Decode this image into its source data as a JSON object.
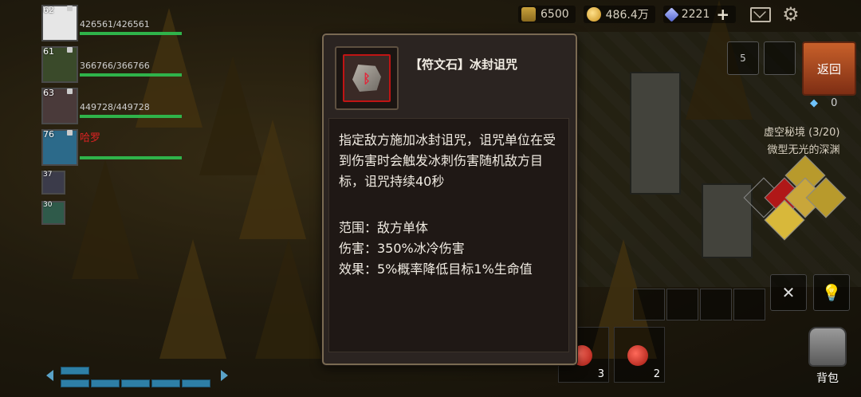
{
  "resources": {
    "wheat": "6500",
    "gold": "486.4万",
    "diamond": "2221",
    "plus": "+"
  },
  "party": [
    {
      "level": "62",
      "hp": "426561/426561",
      "hp_fraction": 1.0
    },
    {
      "level": "61",
      "hp": "366766/366766",
      "hp_fraction": 1.0
    },
    {
      "level": "63",
      "hp": "449728/449728",
      "hp_fraction": 1.0
    },
    {
      "level": "76",
      "name": "哈罗",
      "hp_fraction": 1.0
    },
    {
      "level": "37"
    },
    {
      "level": "30"
    }
  ],
  "right_panel": {
    "back_label": "返回",
    "slot_count": "5",
    "crystal_count": "0",
    "zone_name": "虚空秘境 (3/20)",
    "zone_sub": "微型无光的深渊",
    "bag_label": "背包",
    "potion_counts": [
      "3",
      "2"
    ]
  },
  "tooltip": {
    "title": "【符文石】冰封诅咒",
    "description": "指定敌方施加冰封诅咒，诅咒单位在受到伤害时会触发冰刺伤害随机敌方目标，诅咒持续40秒",
    "range": "范围：敌方单体",
    "damage": "伤害：350%冰冷伤害",
    "effect": "效果：5%概率降低目标1%生命值",
    "rune_glyph": "ᛒ"
  },
  "colors": {
    "rune_border": "#c01414",
    "hp_bar": "#2fb34a",
    "name_red": "#d22222",
    "back_button": "#c8602a"
  }
}
